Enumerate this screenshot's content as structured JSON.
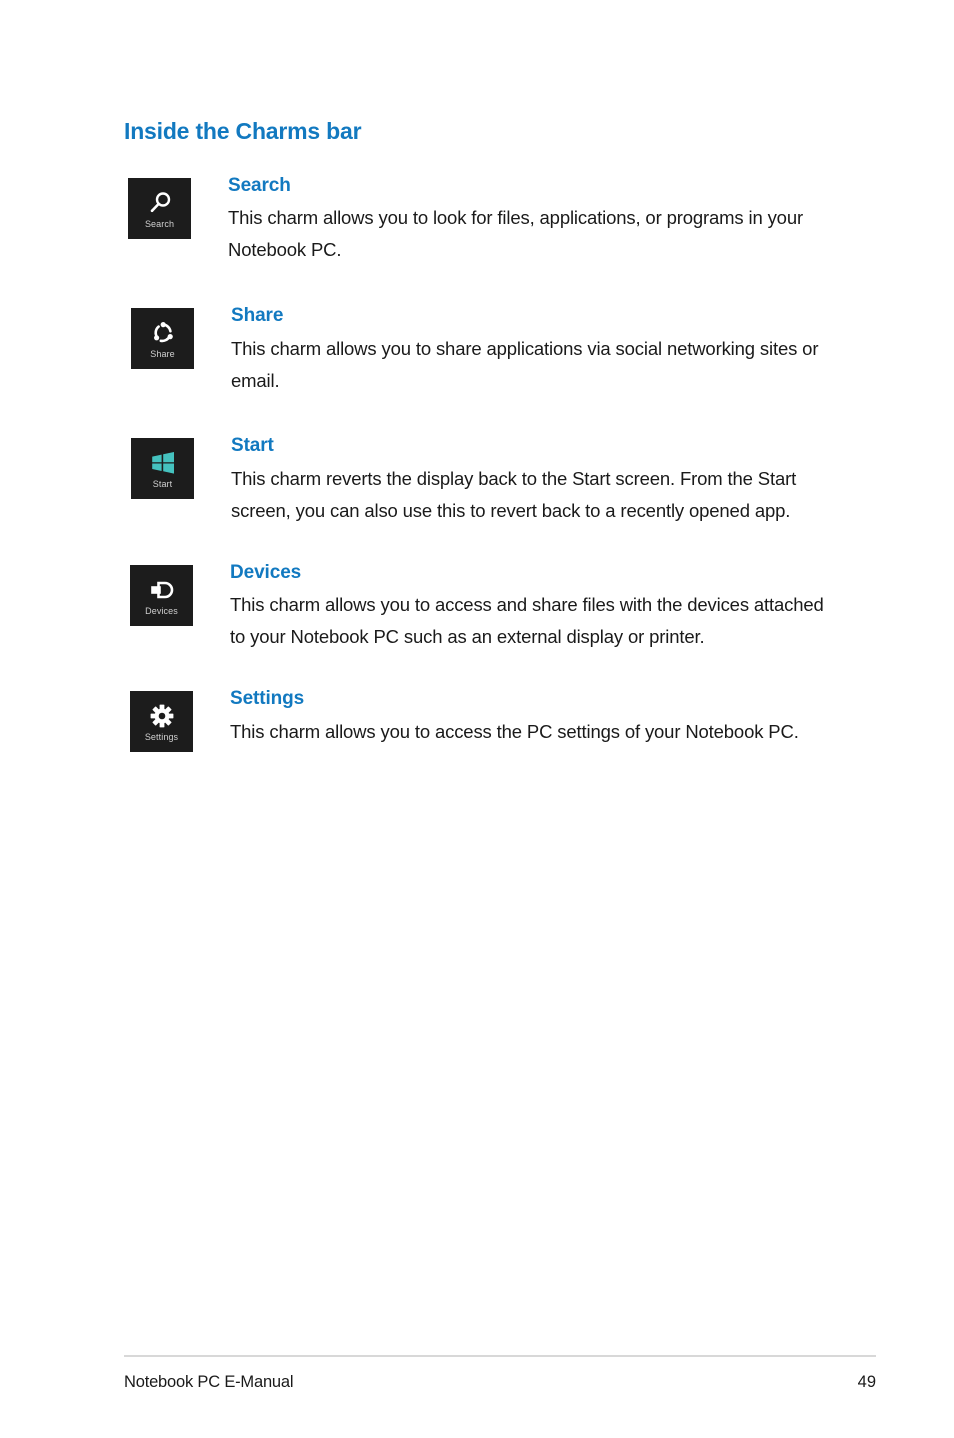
{
  "page": {
    "title": "Inside the Charms bar",
    "accent_color": "#1279c0",
    "text_color": "#1a1a1a",
    "tile_bg_color": "#1c1c1c",
    "start_logo_color": "#45c2bf"
  },
  "charms": [
    {
      "icon": "search-icon",
      "tile_label": "Search",
      "name": "Search",
      "description": "This charm allows you to look for files, applications, or programs in your Notebook PC."
    },
    {
      "icon": "share-icon",
      "tile_label": "Share",
      "name": "Share",
      "description": "This charm allows you to share applications via social networking sites or email."
    },
    {
      "icon": "windows-start-icon",
      "tile_label": "Start",
      "name": "Start",
      "description": "This charm reverts the display back to the Start screen. From the Start screen, you can also use this to revert back to a recently opened app."
    },
    {
      "icon": "devices-icon",
      "tile_label": "Devices",
      "name": "Devices",
      "description": "This charm allows you to access and share files with the devices attached to your Notebook PC such as an external display or printer."
    },
    {
      "icon": "gear-icon",
      "tile_label": "Settings",
      "name": "Settings",
      "description": "This charm allows you to access the PC settings of your Notebook PC."
    }
  ],
  "footer": {
    "document_title": "Notebook PC E-Manual",
    "page_number": "49"
  }
}
